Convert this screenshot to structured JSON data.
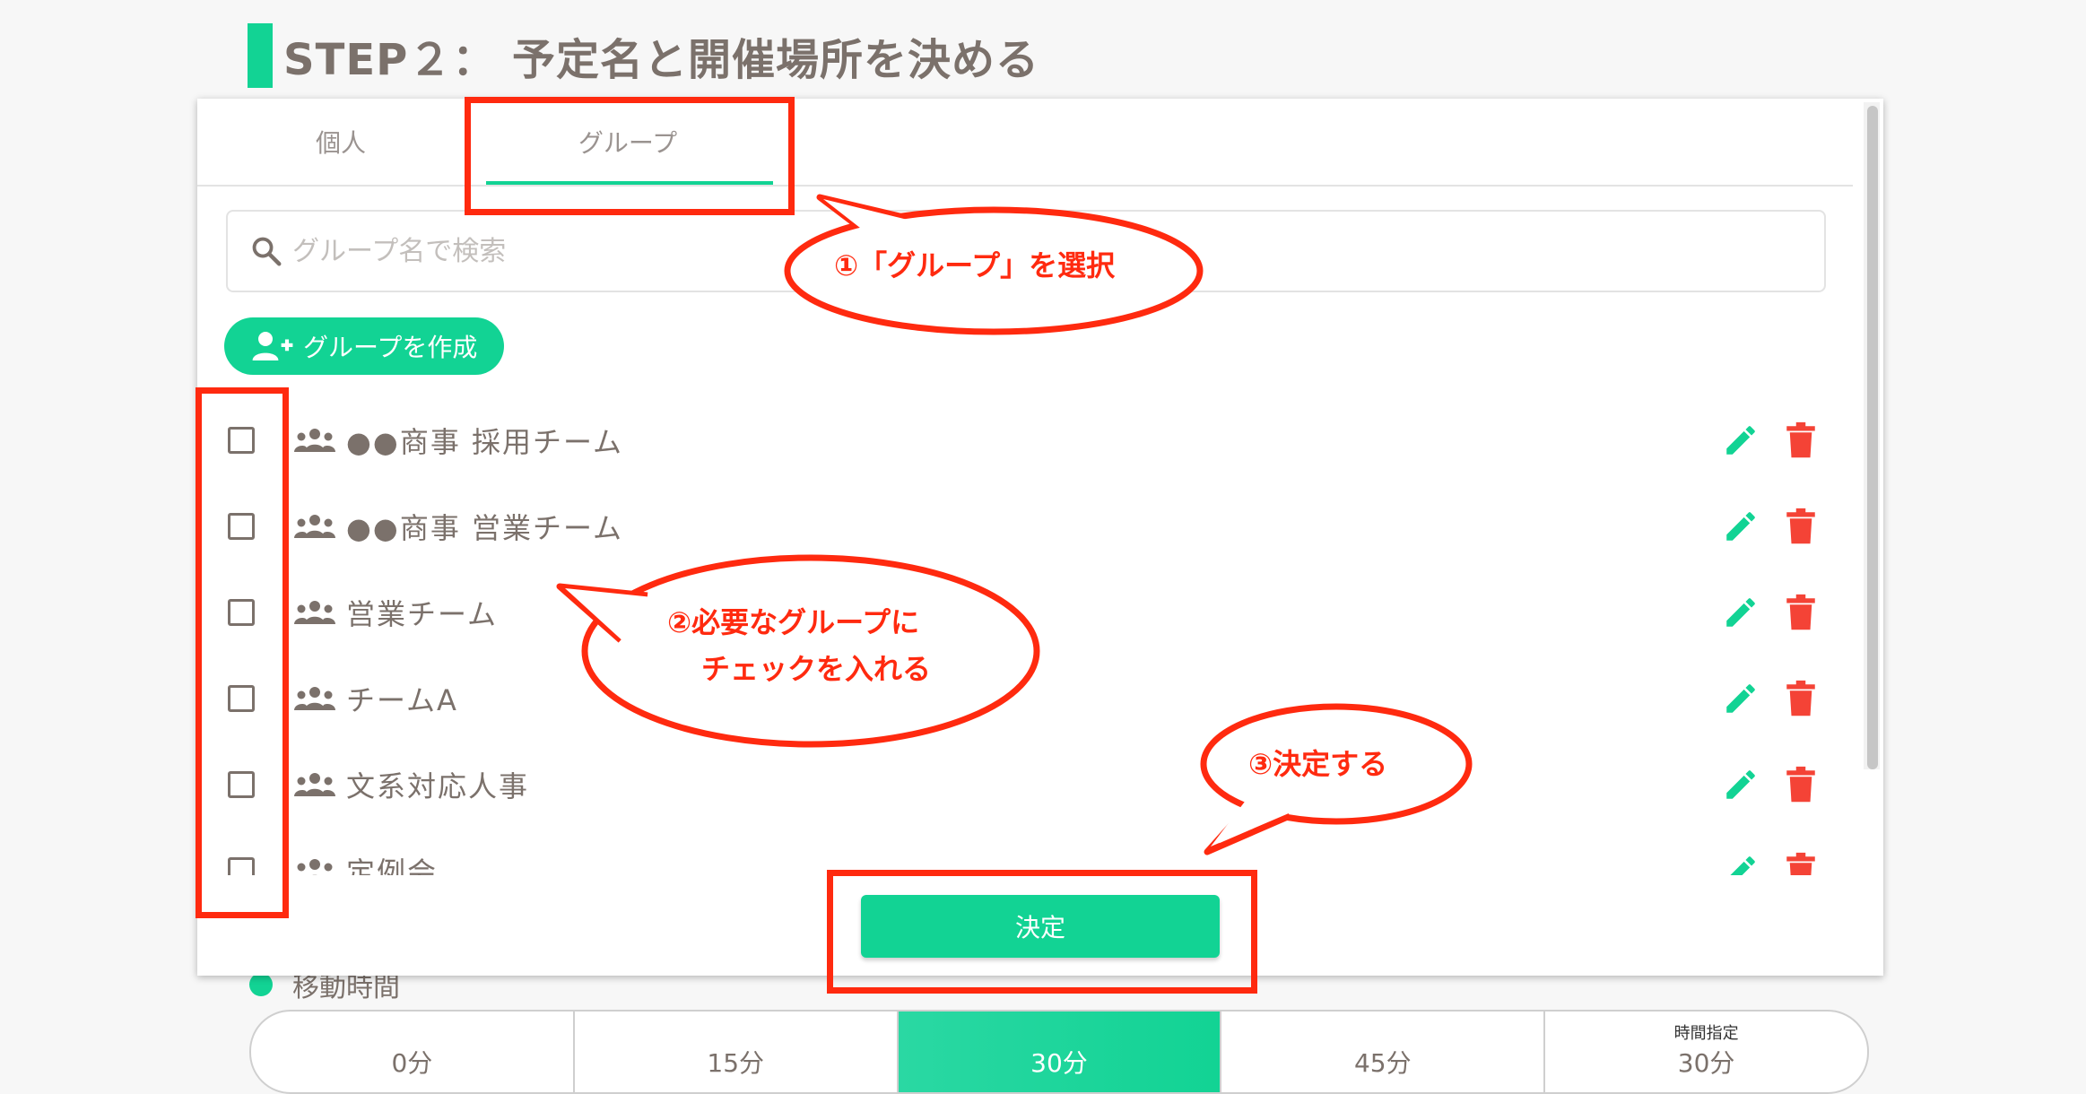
{
  "step_title": "STEP２： 予定名と開催場所を決める",
  "tabs": [
    {
      "label": "個人",
      "active": false
    },
    {
      "label": "グループ",
      "active": true
    }
  ],
  "search": {
    "placeholder": "グループ名で検索",
    "icon": "search-icon"
  },
  "create_button": {
    "label": "グループを作成",
    "icon": "add-person-icon"
  },
  "groups": [
    {
      "name": "●●商事 採用チーム",
      "checked": false
    },
    {
      "name": "●●商事 営業チーム",
      "checked": false
    },
    {
      "name": "営業チーム",
      "checked": false
    },
    {
      "name": "チームA",
      "checked": false
    },
    {
      "name": "文系対応人事",
      "checked": false
    },
    {
      "name": "定例会",
      "checked": false
    }
  ],
  "row_actions": {
    "edit_icon": "pencil-icon",
    "delete_icon": "trash-icon"
  },
  "decide_button": {
    "label": "決定"
  },
  "background": {
    "move_time_label": "移動時間",
    "time_options": [
      "0分",
      "15分",
      "30分",
      "45分",
      "30分"
    ],
    "time_active": "30分",
    "time_custom_label": "時間指定"
  },
  "annotations": {
    "callout_1": "①「グループ」を選択",
    "callout_2_line1": "②必要なグループに",
    "callout_2_line2": "チェックを入れる",
    "callout_3": "③決定する"
  },
  "colors": {
    "accent": "#12d394",
    "text": "#7b716b",
    "danger": "#f44336",
    "annotation": "#ff2a0f"
  }
}
